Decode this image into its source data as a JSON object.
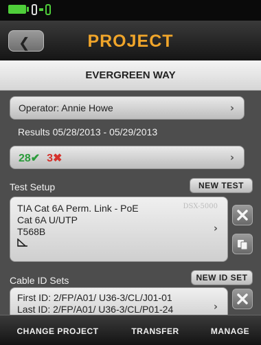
{
  "header": {
    "title": "PROJECT",
    "back_icon": "chevron-left-icon"
  },
  "project": {
    "name": "EVERGREEN WAY"
  },
  "operator": {
    "label": "Operator: Annie Howe"
  },
  "results": {
    "date_range": "Results 05/28/2013 - 05/29/2013",
    "pass_count": "28",
    "fail_count": "3",
    "pass_glyph": "✔",
    "fail_glyph": "✖"
  },
  "test_setup": {
    "label": "Test Setup",
    "new_button": "NEW TEST",
    "lines": [
      "TIA Cat 6A Perm. Link - PoE",
      "Cat 6A U/UTP",
      "T568B"
    ],
    "device": "DSX-5000"
  },
  "cable_ids": {
    "label": "Cable ID Sets",
    "new_button": "NEW ID SET",
    "first_id": "First ID: 2/FP/A01/ U36-3/CL/J01-01",
    "last_id": "Last ID: 2/FP/A01/ U36-3/CL/P01-24"
  },
  "bottom": {
    "change_project": "CHANGE PROJECT",
    "transfer": "TRANSFER",
    "manage": "MANAGE"
  },
  "colors": {
    "accent": "#f0a52a",
    "pass": "#2a9b3a",
    "fail": "#d5322c",
    "battery": "#4fce3a"
  }
}
